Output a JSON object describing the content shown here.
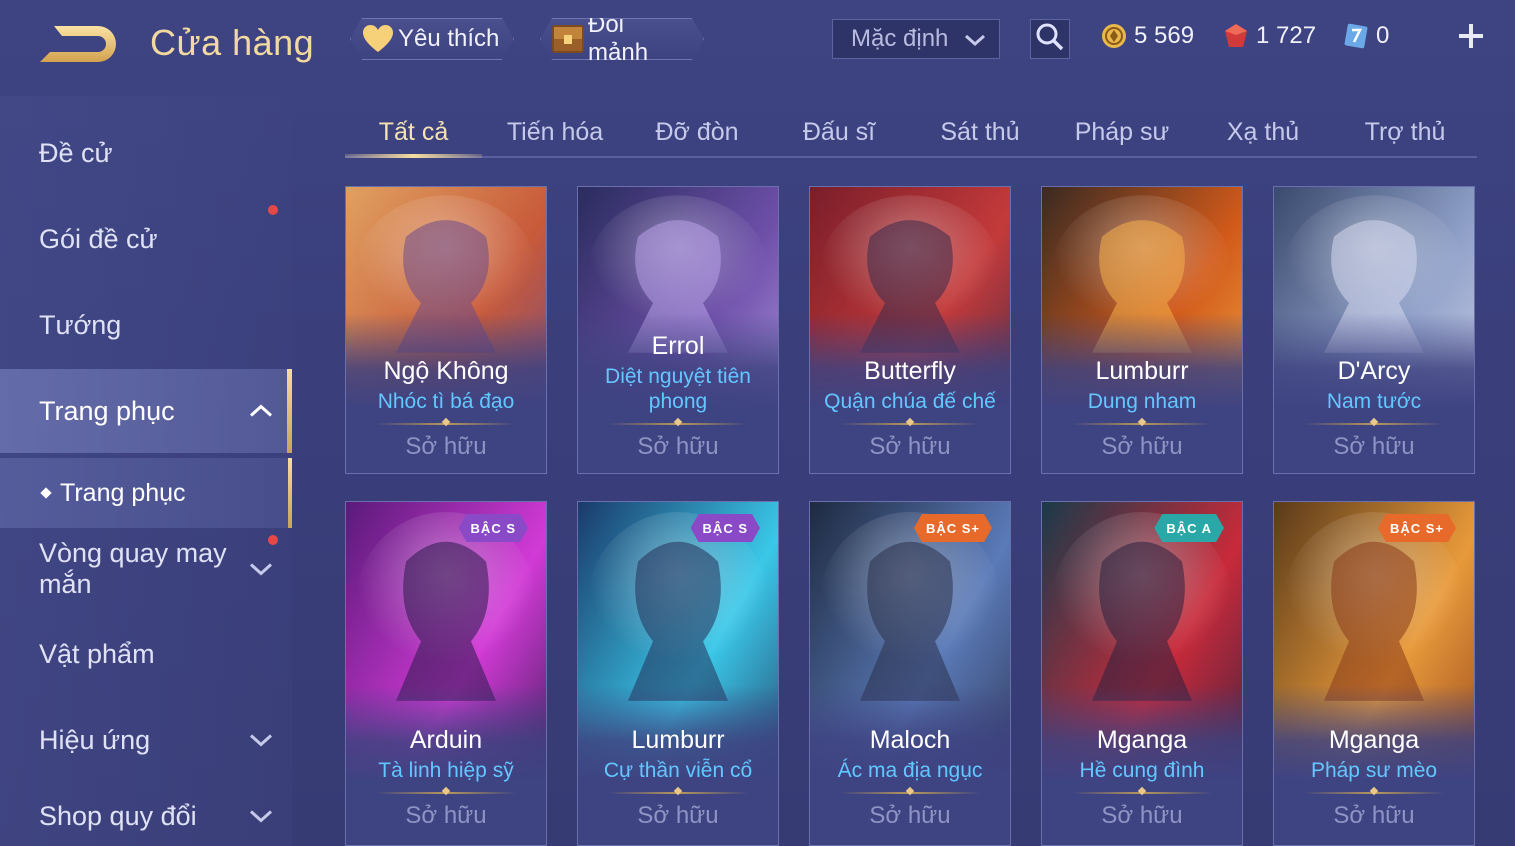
{
  "header": {
    "title": "Cửa hàng",
    "favorites_label": "Yêu thích",
    "shard_exchange_label": "Đổi mảnh",
    "sort_value": "Mặc định",
    "currencies": {
      "gold": "5 569",
      "ruby": "1 727",
      "voucher": "0"
    }
  },
  "sidebar": {
    "items": [
      {
        "label": "Đề cử"
      },
      {
        "label": "Gói đề cử"
      },
      {
        "label": "Tướng"
      },
      {
        "label": "Trang phục"
      },
      {
        "label": "Vòng quay may\nmắn"
      },
      {
        "label": "Vật phẩm"
      },
      {
        "label": "Hiệu ứng"
      },
      {
        "label": "Shop quy đổi"
      }
    ],
    "sub_item": "Trang phục"
  },
  "tabs": [
    {
      "label": "Tất cả"
    },
    {
      "label": "Tiến hóa"
    },
    {
      "label": "Đỡ đòn"
    },
    {
      "label": "Đấu sĩ"
    },
    {
      "label": "Sát thủ"
    },
    {
      "label": "Pháp sư"
    },
    {
      "label": "Xạ thủ"
    },
    {
      "label": "Trợ thủ"
    }
  ],
  "skins": [
    {
      "hero": "Ngộ Không",
      "skin": "Nhóc tì bá đạo",
      "status": "Sở hữu",
      "tier": "",
      "palette": [
        "#e0a060",
        "#c85a3a",
        "#6b4a8a"
      ]
    },
    {
      "hero": "Errol",
      "skin": "Diệt nguyệt tiên phong",
      "status": "Sở hữu",
      "tier": "",
      "palette": [
        "#2a2c5e",
        "#6d4fa8",
        "#b8a0e8"
      ]
    },
    {
      "hero": "Butterfly",
      "skin": "Quận chúa đế chế",
      "status": "Sở hữu",
      "tier": "",
      "palette": [
        "#7a1e2a",
        "#c43a3a",
        "#3a2a4a"
      ]
    },
    {
      "hero": "Lumburr",
      "skin": "Dung nham",
      "status": "Sở hữu",
      "tier": "",
      "palette": [
        "#3a2a22",
        "#d25a1a",
        "#f5b04a"
      ]
    },
    {
      "hero": "D'Arcy",
      "skin": "Nam tước",
      "status": "Sở hữu",
      "tier": "",
      "palette": [
        "#3a4a6e",
        "#8fa0c8",
        "#d6d8ee"
      ]
    },
    {
      "hero": "Arduin",
      "skin": "Tà linh hiệp sỹ",
      "status": "Sở hữu",
      "tier": "BẬC S",
      "palette": [
        "#5a1a7a",
        "#d23ad6",
        "#2a1a4a"
      ]
    },
    {
      "hero": "Lumburr",
      "skin": "Cự thần viễn cổ",
      "status": "Sở hữu",
      "tier": "BẬC S",
      "palette": [
        "#1a3a6a",
        "#3ac8e8",
        "#24305a"
      ]
    },
    {
      "hero": "Maloch",
      "skin": "Ác ma địa ngục",
      "status": "Sở hữu",
      "tier": "BẬC S+",
      "palette": [
        "#1e2a40",
        "#5a7ab8",
        "#2a2f4a"
      ]
    },
    {
      "hero": "Mganga",
      "skin": "Hề cung đình",
      "status": "Sở hữu",
      "tier": "BẬC A",
      "palette": [
        "#1a3a4a",
        "#c82a3a",
        "#2a2040"
      ]
    },
    {
      "hero": "Mganga",
      "skin": "Pháp sư mèo",
      "status": "Sở hữu",
      "tier": "BẬC S+",
      "palette": [
        "#5a3a1a",
        "#e89a3a",
        "#8a3a1a"
      ]
    }
  ],
  "colors": {
    "tier_s": "#8a4ac8",
    "tier_s_plus": "#e86a2a",
    "tier_a": "#2aa8a8",
    "accent_gold": "#f2d9a0",
    "skin_name": "#63c7ff"
  },
  "icons": {
    "back": "back-arrow-icon",
    "favorites": "heart-icon",
    "shards": "chest-icon",
    "sort": "chevron-down-icon",
    "search": "search-icon",
    "gold": "gold-coin-icon",
    "ruby": "ruby-icon",
    "voucher": "voucher-icon",
    "add": "plus-icon"
  }
}
